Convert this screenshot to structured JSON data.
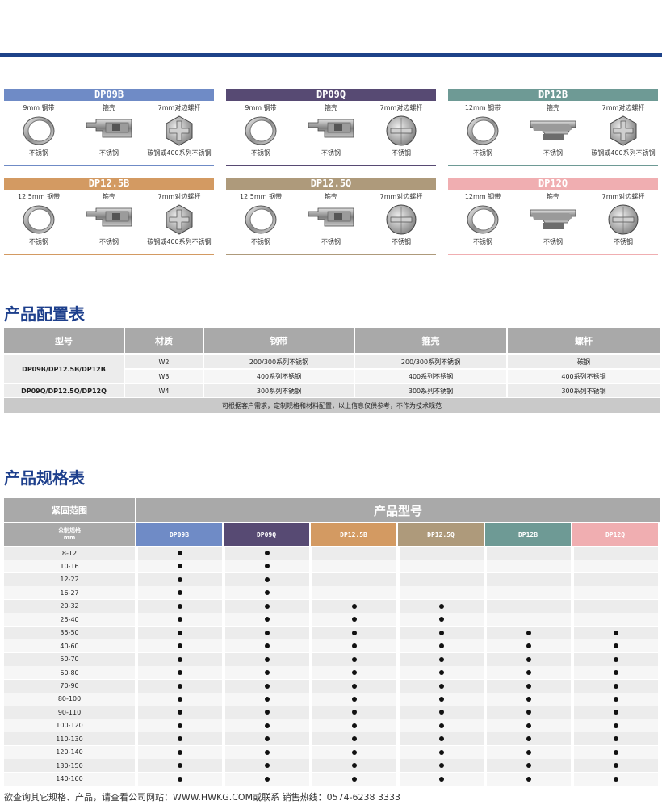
{
  "cards": [
    {
      "model": "DP09B",
      "color": "#6f8bc6",
      "band_label": "9mm 钢带",
      "housing_label": "箍壳",
      "screw_label": "7mm对边螺杆",
      "band_mat": "不锈钢",
      "housing_mat": "不锈钢",
      "screw_mat": "碳钢或400系列不锈钢",
      "band_shape": "ring",
      "housing_shape": "housing",
      "screw_shape": "hex"
    },
    {
      "model": "DP09Q",
      "color": "#574a73",
      "band_label": "9mm 钢带",
      "housing_label": "箍壳",
      "screw_label": "7mm对边螺杆",
      "band_mat": "不锈钢",
      "housing_mat": "不锈钢",
      "screw_mat": "不锈钢",
      "band_shape": "ring",
      "housing_shape": "housing",
      "screw_shape": "round"
    },
    {
      "model": "DP12B",
      "color": "#6e9a95",
      "band_label": "12mm 钢带",
      "housing_label": "箍壳",
      "screw_label": "7mm对边螺杆",
      "band_mat": "不锈钢",
      "housing_mat": "不锈钢",
      "screw_mat": "碳钢或400系列不锈钢",
      "band_shape": "ring",
      "housing_shape": "housing2",
      "screw_shape": "hex"
    },
    {
      "model": "DP12.5B",
      "color": "#d39a62",
      "band_label": "12.5mm 钢带",
      "housing_label": "箍壳",
      "screw_label": "7mm对边螺杆",
      "band_mat": "不锈钢",
      "housing_mat": "不锈钢",
      "screw_mat": "碳钢或400系列不锈钢",
      "band_shape": "ring",
      "housing_shape": "housing",
      "screw_shape": "hex"
    },
    {
      "model": "DP12.5Q",
      "color": "#ae9a7b",
      "band_label": "12.5mm 钢带",
      "housing_label": "箍壳",
      "screw_label": "7mm对边螺杆",
      "band_mat": "不锈钢",
      "housing_mat": "不锈钢",
      "screw_mat": "不锈钢",
      "band_shape": "ring",
      "housing_shape": "housing",
      "screw_shape": "round"
    },
    {
      "model": "DP12Q",
      "color": "#f0aeb1",
      "band_label": "12mm 钢带",
      "housing_label": "箍壳",
      "screw_label": "7mm对边螺杆",
      "band_mat": "不锈钢",
      "housing_mat": "不锈钢",
      "screw_mat": "不锈钢",
      "band_shape": "ring",
      "housing_shape": "housing2",
      "screw_shape": "round"
    }
  ],
  "config": {
    "title": "产品配置表",
    "headers": [
      "型号",
      "材质",
      "钢带",
      "箍壳",
      "螺杆"
    ],
    "groups": [
      {
        "model": "DP09B/DP12.5B/DP12B",
        "rows": [
          [
            "W2",
            "200/300系列不锈钢",
            "200/300系列不锈钢",
            "碳钢"
          ],
          [
            "W3",
            "400系列不锈钢",
            "400系列不锈钢",
            "400系列不锈钢"
          ]
        ]
      },
      {
        "model": "DP09Q/DP12.5Q/DP12Q",
        "rows": [
          [
            "W4",
            "300系列不锈钢",
            "300系列不锈钢",
            "300系列不锈钢"
          ]
        ]
      }
    ],
    "note": "可根据客户需求，定制规格和材料配置，以上信息仅供参考，不作为技术规范"
  },
  "spec": {
    "title": "产品规格表",
    "range_header": "紧固范围",
    "model_header": "产品型号",
    "range_sub1": "公制规格",
    "range_sub2": "mm",
    "models": [
      {
        "name": "DP09B",
        "color": "#6f8bc6"
      },
      {
        "name": "DP09Q",
        "color": "#574a73"
      },
      {
        "name": "DP12.5B",
        "color": "#d39a62"
      },
      {
        "name": "DP12.5Q",
        "color": "#ae9a7b"
      },
      {
        "name": "DP12B",
        "color": "#6e9a95"
      },
      {
        "name": "DP12Q",
        "color": "#f0aeb1"
      }
    ],
    "rows": [
      {
        "range": "8-12",
        "avail": [
          1,
          1,
          0,
          0,
          0,
          0
        ]
      },
      {
        "range": "10-16",
        "avail": [
          1,
          1,
          0,
          0,
          0,
          0
        ]
      },
      {
        "range": "12-22",
        "avail": [
          1,
          1,
          0,
          0,
          0,
          0
        ]
      },
      {
        "range": "16-27",
        "avail": [
          1,
          1,
          0,
          0,
          0,
          0
        ]
      },
      {
        "range": "20-32",
        "avail": [
          1,
          1,
          1,
          1,
          0,
          0
        ]
      },
      {
        "range": "25-40",
        "avail": [
          1,
          1,
          1,
          1,
          0,
          0
        ]
      },
      {
        "range": "35-50",
        "avail": [
          1,
          1,
          1,
          1,
          1,
          1
        ]
      },
      {
        "range": "40-60",
        "avail": [
          1,
          1,
          1,
          1,
          1,
          1
        ]
      },
      {
        "range": "50-70",
        "avail": [
          1,
          1,
          1,
          1,
          1,
          1
        ]
      },
      {
        "range": "60-80",
        "avail": [
          1,
          1,
          1,
          1,
          1,
          1
        ]
      },
      {
        "range": "70-90",
        "avail": [
          1,
          1,
          1,
          1,
          1,
          1
        ]
      },
      {
        "range": "80-100",
        "avail": [
          1,
          1,
          1,
          1,
          1,
          1
        ]
      },
      {
        "range": "90-110",
        "avail": [
          1,
          1,
          1,
          1,
          1,
          1
        ]
      },
      {
        "range": "100-120",
        "avail": [
          1,
          1,
          1,
          1,
          1,
          1
        ]
      },
      {
        "range": "110-130",
        "avail": [
          1,
          1,
          1,
          1,
          1,
          1
        ]
      },
      {
        "range": "120-140",
        "avail": [
          1,
          1,
          1,
          1,
          1,
          1
        ]
      },
      {
        "range": "130-150",
        "avail": [
          1,
          1,
          1,
          1,
          1,
          1
        ]
      },
      {
        "range": "140-160",
        "avail": [
          1,
          1,
          1,
          1,
          1,
          1
        ]
      }
    ]
  },
  "footer": "欲查询其它规格、产品，请查看公司网站：WWW.HWKG.COM或联系 销售热线：0574-6238 3333"
}
